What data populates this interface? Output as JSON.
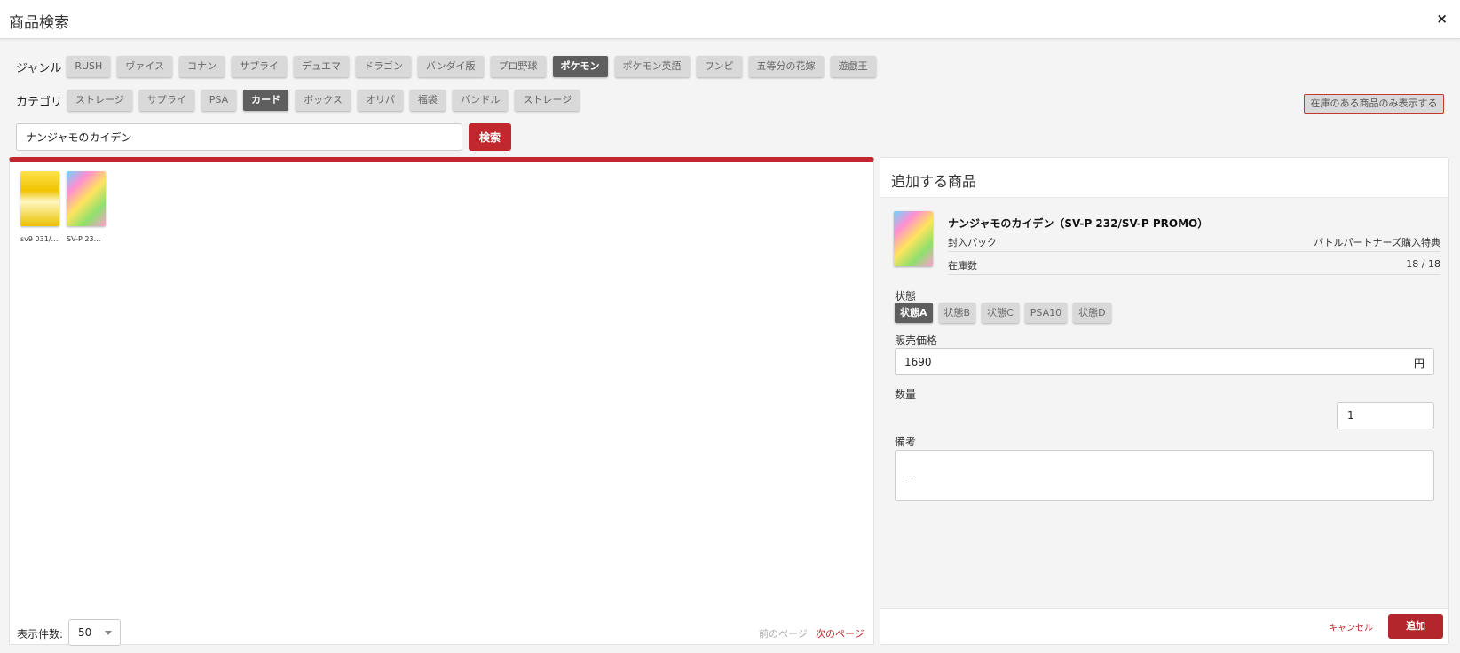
{
  "header": {
    "title": "商品検索",
    "close_icon": "×"
  },
  "genre": {
    "label": "ジャンル",
    "items": [
      "RUSH",
      "ヴァイス",
      "コナン",
      "サプライ",
      "デュエマ",
      "ドラゴン",
      "バンダイ版",
      "プロ野球",
      "ポケモン",
      "ポケモン英語",
      "ワンピ",
      "五等分の花嫁",
      "遊戯王"
    ],
    "active": "ポケモン"
  },
  "category": {
    "label": "カテゴリ",
    "items": [
      "ストレージ",
      "サプライ",
      "PSA",
      "カード",
      "ボックス",
      "オリパ",
      "福袋",
      "バンドル",
      "ストレージ"
    ],
    "active": "カード"
  },
  "stock_toggle": "在庫のある商品のみ表示する",
  "search": {
    "value": "ナンジャモのカイデン",
    "button": "検索"
  },
  "results": {
    "items": [
      {
        "caption": "sv9 031/…"
      },
      {
        "caption": "SV-P 23…"
      }
    ],
    "page_size_label": "表示件数:",
    "page_size": "50",
    "prev": "前のページ",
    "next": "次のページ"
  },
  "panel": {
    "title": "追加する商品",
    "product_name": "ナンジャモのカイデン（SV-P 232/SV-P PROMO）",
    "pack_label": "封入パック",
    "pack_value": "バトルパートナーズ購入特典",
    "stock_label": "在庫数",
    "stock_value": "18 / 18",
    "condition_label": "状態",
    "conditions": [
      "状態A",
      "状態B",
      "状態C",
      "PSA10",
      "状態D"
    ],
    "condition_active": "状態A",
    "price_label": "販売価格",
    "price": "1690",
    "price_unit": "円",
    "qty_label": "数量",
    "qty": "1",
    "memo_label": "備考",
    "memo": "---",
    "cancel": "キャンセル",
    "add": "追加"
  }
}
